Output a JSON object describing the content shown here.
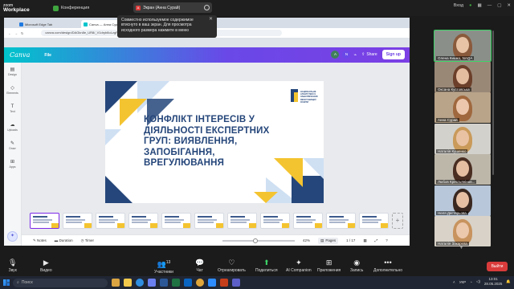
{
  "zoom": {
    "logo_line1": "zoom",
    "logo_line2": "Workplace",
    "meeting_title": "Конференция",
    "share_pill_label": "Экран (Анна Сурай)",
    "tooltip_text": "Совместно используемое содержимое втиснуто в ваш экран. Для просмотра исходного размера нажмите в меню",
    "signin": "Вход",
    "toolbar": {
      "audio": "Звук",
      "video": "Видео",
      "participants": "Участники",
      "participants_count": "13",
      "chat": "Чат",
      "react": "Отреагировать",
      "share": "Поделиться",
      "ai": "AI Companion",
      "apps": "Приложения",
      "record": "Запись",
      "more": "Дополнительно",
      "leave": "Выйти"
    }
  },
  "browser": {
    "tabs": [
      {
        "label": "Microsoft Edge Tab",
        "color": "#1f7ae0"
      },
      {
        "label": "Canva — Анна Сурай",
        "color": "#00c4cc"
      }
    ],
    "address": "canva.com/design/DAGkn8e_UR8/_V1dryb8oLzgRxZnPlmOIQ/edit"
  },
  "canva": {
    "logo": "Canva",
    "file_menu": "File",
    "share": "Share",
    "signup": "Sign up",
    "avatars": [
      {
        "initial": "A",
        "color": "#3f7f5c"
      },
      {
        "initial": "N",
        "color": "#6a48e8"
      }
    ],
    "sidebar": [
      "Design",
      "Elements",
      "Text",
      "Uploads",
      "Draw",
      "Apps"
    ],
    "slide": {
      "title": "КОНФЛІКТ ІНТЕРЕСІВ У ДІЯЛЬНОСТІ ЕКСПЕРТНИХ ГРУП: ВИЯВЛЕННЯ, ЗАПОБІГАННЯ, ВРЕГУЛЮВАННЯ",
      "logo_text": "НАЦІОНАЛЬНЕ АГЕНТСТВО ІЗ ЗАБЕЗПЕЧЕННЯ ЯКОСТІ ВИЩОЇ ОСВІТИ",
      "accent_blue": "#25467a",
      "accent_yellow": "#f4c430",
      "accent_light": "#cfe0f3"
    },
    "thumbnail_count": 11,
    "footer": {
      "notes": "Notes",
      "duration": "Duration",
      "timer": "Timer",
      "zoom_level": "42%",
      "pages_label": "Pages",
      "page_indicator": "1 / 17"
    }
  },
  "participants": [
    {
      "name": "Олена Кишко, NAQA",
      "bg": "#8b8f8a",
      "skin": "#e8c3a6",
      "hair": "#8a5a3c",
      "speaking": true
    },
    {
      "name": "Оксана Кустовська",
      "bg": "#9a8877",
      "skin": "#e4bca0",
      "hair": "#6b3f2a",
      "speaking": false
    },
    {
      "name": "Анна Сурай",
      "bg": "#b9a48a",
      "skin": "#ecc7ad",
      "hair": "#a0683e",
      "speaking": false
    },
    {
      "name": "Наталія Кушенко",
      "bg": "#d3d1cc",
      "skin": "#e9c2a4",
      "hair": "#c99a5a",
      "speaking": false
    },
    {
      "name": "Любов Крестьянінов...",
      "bg": "#bdb7aa",
      "skin": "#e6bfa2",
      "hair": "#4a2e22",
      "speaking": false
    },
    {
      "name": "Неля Дегтярьова",
      "bg": "#b8c7d9",
      "skin": "#e7c0a4",
      "hair": "#3a2820",
      "speaking": false
    },
    {
      "name": "Наталія Закарєва",
      "bg": "#d8d2c8",
      "skin": "#ecc8ad",
      "hair": "#c8935e",
      "speaking": false
    }
  ],
  "taskbar": {
    "search_placeholder": "Поиск",
    "lang": "УКР",
    "time": "13:01",
    "date": "28.05.2025"
  }
}
